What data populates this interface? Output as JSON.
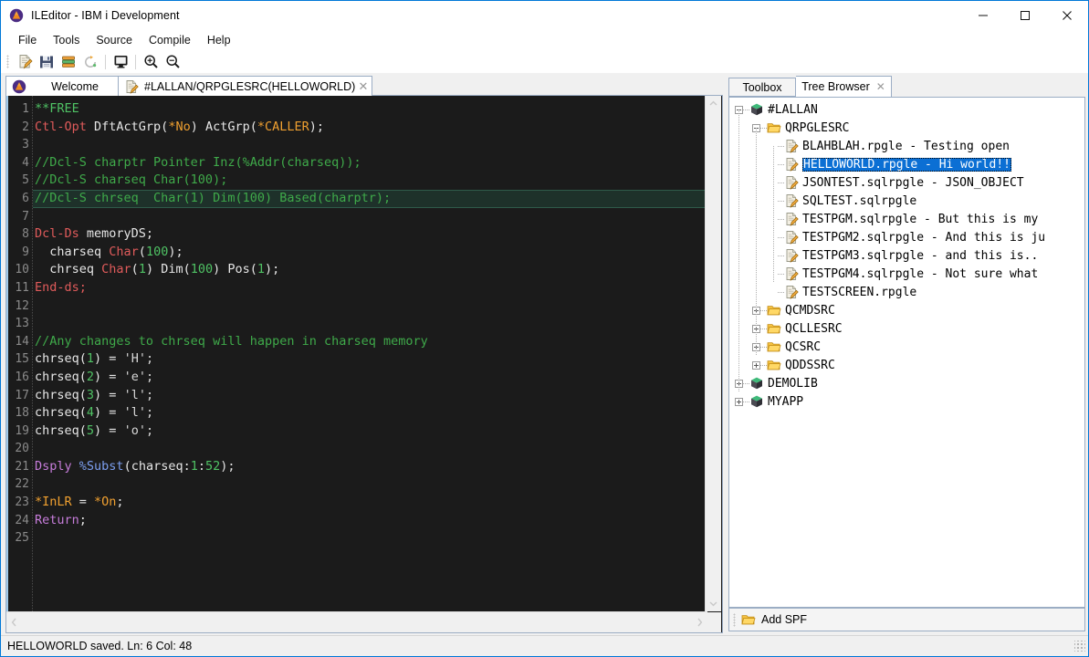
{
  "window": {
    "title": "ILEditor - IBM i Development",
    "app_icon": "ile-editor-logo-icon",
    "minimize_label": "minimize-icon",
    "maximize_label": "maximize-icon",
    "close_label": "close-icon"
  },
  "menubar": {
    "items": [
      {
        "label": "File"
      },
      {
        "label": "Tools"
      },
      {
        "label": "Source"
      },
      {
        "label": "Compile"
      },
      {
        "label": "Help"
      }
    ]
  },
  "toolbar": {
    "buttons": [
      {
        "name": "new-source-icon",
        "title": "New"
      },
      {
        "name": "save-icon",
        "title": "Save"
      },
      {
        "name": "library-list-icon",
        "title": "Library list"
      },
      {
        "name": "refresh-icon",
        "title": "Refresh"
      },
      {
        "name": "terminal-icon",
        "title": "Terminal"
      },
      {
        "name": "zoom-in-icon",
        "title": "Zoom in"
      },
      {
        "name": "zoom-out-icon",
        "title": "Zoom out"
      }
    ]
  },
  "editor": {
    "tabs": [
      {
        "label": "Welcome",
        "icon": "ile-editor-logo-icon",
        "closable": false,
        "active": false
      },
      {
        "label": "#LALLAN/QRPGLESRC(HELLOWORLD)",
        "icon": "source-file-icon",
        "closable": true,
        "close_glyph": "✕",
        "active": true
      }
    ],
    "current_line": 6,
    "colors": {
      "background": "#1b1b1b",
      "current_line": "#1e312a",
      "line_number": "#8a8a8a",
      "comment": "#3faa4a",
      "keyword": "#e05b5b",
      "special_value": "#f0a030",
      "builtin": "#7c9ff0",
      "control": "#c77ddb",
      "plain": "#e6e6e6"
    },
    "lines": [
      {
        "n": 1,
        "tokens": [
          {
            "t": "**FREE",
            "c": "t-op"
          }
        ]
      },
      {
        "n": 2,
        "tokens": [
          {
            "t": "Ctl-Opt",
            "c": "t-kw"
          },
          {
            "t": " DftActGrp(",
            "c": "t-pln"
          },
          {
            "t": "*No",
            "c": "t-spv"
          },
          {
            "t": ") ActGrp(",
            "c": "t-pln"
          },
          {
            "t": "*CALLER",
            "c": "t-spv"
          },
          {
            "t": ");",
            "c": "t-pln"
          }
        ]
      },
      {
        "n": 3,
        "tokens": []
      },
      {
        "n": 4,
        "tokens": [
          {
            "t": "//Dcl-S charptr Pointer Inz(%Addr(charseq));",
            "c": "t-cmt"
          }
        ]
      },
      {
        "n": 5,
        "tokens": [
          {
            "t": "//Dcl-S charseq Char(100);",
            "c": "t-cmt"
          }
        ]
      },
      {
        "n": 6,
        "tokens": [
          {
            "t": "//Dcl-S chrseq  Char(1) Dim(100) Based(charptr);",
            "c": "t-cmt"
          }
        ]
      },
      {
        "n": 7,
        "tokens": []
      },
      {
        "n": 8,
        "tokens": [
          {
            "t": "Dcl-Ds",
            "c": "t-kw"
          },
          {
            "t": " memoryDS;",
            "c": "t-pln"
          }
        ]
      },
      {
        "n": 9,
        "tokens": [
          {
            "t": "  charseq ",
            "c": "t-pln"
          },
          {
            "t": "Char",
            "c": "t-kw"
          },
          {
            "t": "(",
            "c": "t-pln"
          },
          {
            "t": "100",
            "c": "t-num"
          },
          {
            "t": ");",
            "c": "t-pln"
          }
        ]
      },
      {
        "n": 10,
        "tokens": [
          {
            "t": "  chrseq ",
            "c": "t-pln"
          },
          {
            "t": "Char",
            "c": "t-kw"
          },
          {
            "t": "(",
            "c": "t-pln"
          },
          {
            "t": "1",
            "c": "t-num"
          },
          {
            "t": ") Dim(",
            "c": "t-pln"
          },
          {
            "t": "100",
            "c": "t-num"
          },
          {
            "t": ") Pos(",
            "c": "t-pln"
          },
          {
            "t": "1",
            "c": "t-num"
          },
          {
            "t": ");",
            "c": "t-pln"
          }
        ]
      },
      {
        "n": 11,
        "tokens": [
          {
            "t": "End-ds;",
            "c": "t-kw"
          }
        ]
      },
      {
        "n": 12,
        "tokens": []
      },
      {
        "n": 13,
        "tokens": []
      },
      {
        "n": 14,
        "tokens": [
          {
            "t": "//Any changes to chrseq will happen in charseq memory",
            "c": "t-cmt"
          }
        ]
      },
      {
        "n": 15,
        "tokens": [
          {
            "t": "chrseq(",
            "c": "t-pln"
          },
          {
            "t": "1",
            "c": "t-num"
          },
          {
            "t": ") = ",
            "c": "t-pln"
          },
          {
            "t": "'H';",
            "c": "t-str"
          }
        ]
      },
      {
        "n": 16,
        "tokens": [
          {
            "t": "chrseq(",
            "c": "t-pln"
          },
          {
            "t": "2",
            "c": "t-num"
          },
          {
            "t": ") = ",
            "c": "t-pln"
          },
          {
            "t": "'e';",
            "c": "t-str"
          }
        ]
      },
      {
        "n": 17,
        "tokens": [
          {
            "t": "chrseq(",
            "c": "t-pln"
          },
          {
            "t": "3",
            "c": "t-num"
          },
          {
            "t": ") = ",
            "c": "t-pln"
          },
          {
            "t": "'l';",
            "c": "t-str"
          }
        ]
      },
      {
        "n": 18,
        "tokens": [
          {
            "t": "chrseq(",
            "c": "t-pln"
          },
          {
            "t": "4",
            "c": "t-num"
          },
          {
            "t": ") = ",
            "c": "t-pln"
          },
          {
            "t": "'l';",
            "c": "t-str"
          }
        ]
      },
      {
        "n": 19,
        "tokens": [
          {
            "t": "chrseq(",
            "c": "t-pln"
          },
          {
            "t": "5",
            "c": "t-num"
          },
          {
            "t": ") = ",
            "c": "t-pln"
          },
          {
            "t": "'o';",
            "c": "t-str"
          }
        ]
      },
      {
        "n": 20,
        "tokens": []
      },
      {
        "n": 21,
        "tokens": [
          {
            "t": "Dsply",
            "c": "t-ctl"
          },
          {
            "t": " ",
            "c": "t-pln"
          },
          {
            "t": "%Subst",
            "c": "t-bif"
          },
          {
            "t": "(charseq:",
            "c": "t-pln"
          },
          {
            "t": "1",
            "c": "t-num"
          },
          {
            "t": ":",
            "c": "t-pln"
          },
          {
            "t": "52",
            "c": "t-num"
          },
          {
            "t": ");",
            "c": "t-pln"
          }
        ]
      },
      {
        "n": 22,
        "tokens": []
      },
      {
        "n": 23,
        "tokens": [
          {
            "t": "*InLR",
            "c": "t-spv"
          },
          {
            "t": " = ",
            "c": "t-pln"
          },
          {
            "t": "*On",
            "c": "t-spv"
          },
          {
            "t": ";",
            "c": "t-pln"
          }
        ]
      },
      {
        "n": 24,
        "tokens": [
          {
            "t": "Return",
            "c": "t-ctl"
          },
          {
            "t": ";",
            "c": "t-pln"
          }
        ]
      },
      {
        "n": 25,
        "tokens": []
      }
    ]
  },
  "right_panel": {
    "tabs": [
      {
        "label": "Toolbox",
        "active": false,
        "closable": false
      },
      {
        "label": "Tree Browser",
        "active": true,
        "closable": true,
        "close_glyph": "✕"
      }
    ],
    "tree": [
      {
        "level": 0,
        "expander": "minus",
        "icon": "library-cube-icon",
        "label": "#LALLAN",
        "selected": false
      },
      {
        "level": 1,
        "expander": "minus",
        "icon": "folder-open-icon",
        "label": "QRPGLESRC",
        "selected": false
      },
      {
        "level": 2,
        "expander": "none",
        "icon": "source-file-icon",
        "label": "BLAHBLAH.rpgle - Testing open",
        "selected": false
      },
      {
        "level": 2,
        "expander": "none",
        "icon": "source-file-icon",
        "label": "HELLOWORLD.rpgle - Hi world!!",
        "selected": true
      },
      {
        "level": 2,
        "expander": "none",
        "icon": "source-file-icon",
        "label": "JSONTEST.sqlrpgle - JSON_OBJECT",
        "selected": false
      },
      {
        "level": 2,
        "expander": "none",
        "icon": "source-file-icon",
        "label": "SQLTEST.sqlrpgle",
        "selected": false
      },
      {
        "level": 2,
        "expander": "none",
        "icon": "source-file-icon",
        "label": "TESTPGM.sqlrpgle - But this is my",
        "selected": false
      },
      {
        "level": 2,
        "expander": "none",
        "icon": "source-file-icon",
        "label": "TESTPGM2.sqlrpgle - And this is ju",
        "selected": false
      },
      {
        "level": 2,
        "expander": "none",
        "icon": "source-file-icon",
        "label": "TESTPGM3.sqlrpgle - and this is..",
        "selected": false
      },
      {
        "level": 2,
        "expander": "none",
        "icon": "source-file-icon",
        "label": "TESTPGM4.sqlrpgle - Not sure what",
        "selected": false
      },
      {
        "level": 2,
        "expander": "none",
        "icon": "source-file-icon",
        "label": "TESTSCREEN.rpgle",
        "selected": false
      },
      {
        "level": 1,
        "expander": "plus",
        "icon": "folder-open-icon",
        "label": "QCMDSRC",
        "selected": false
      },
      {
        "level": 1,
        "expander": "plus",
        "icon": "folder-open-icon",
        "label": "QCLLESRC",
        "selected": false
      },
      {
        "level": 1,
        "expander": "plus",
        "icon": "folder-open-icon",
        "label": "QCSRC",
        "selected": false
      },
      {
        "level": 1,
        "expander": "plus",
        "icon": "folder-open-icon",
        "label": "QDDSSRC",
        "selected": false
      },
      {
        "level": 0,
        "expander": "plus",
        "icon": "library-cube-icon",
        "label": "DEMOLIB",
        "selected": false
      },
      {
        "level": 0,
        "expander": "plus",
        "icon": "library-cube-icon",
        "label": "MYAPP",
        "selected": false
      }
    ],
    "add_spf": {
      "label": "Add SPF",
      "icon": "folder-open-icon"
    }
  },
  "statusbar": {
    "text": "HELLOWORLD saved.  Ln: 6 Col: 48"
  }
}
